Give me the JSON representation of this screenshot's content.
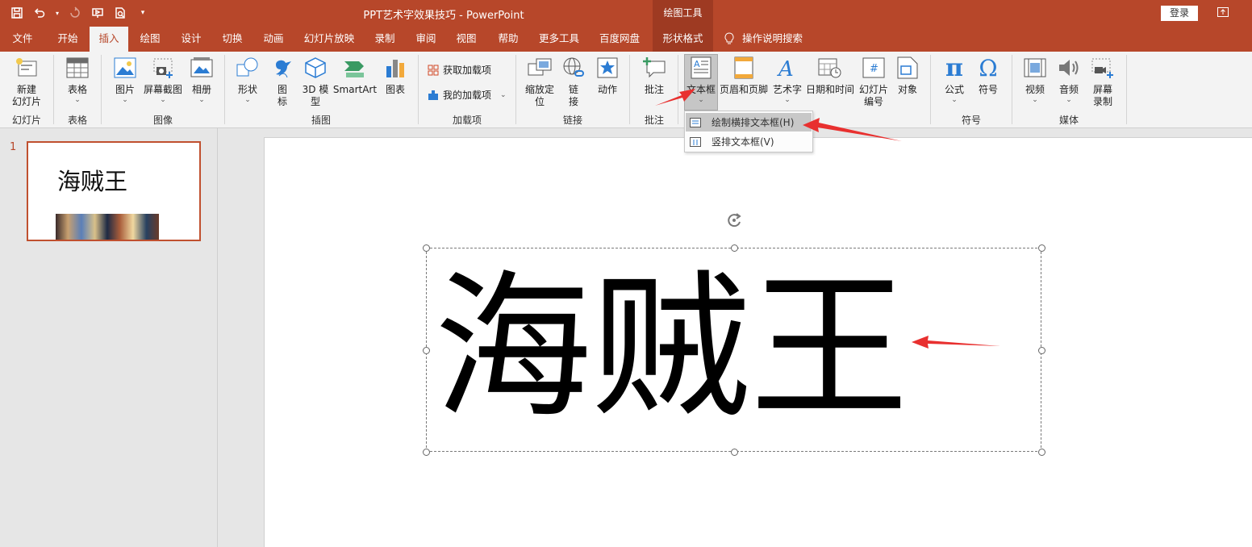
{
  "window": {
    "title": "PPT艺术字效果技巧  -  PowerPoint",
    "context_group": "绘图工具",
    "signin_label": "登录"
  },
  "tabs": [
    {
      "label": "文件"
    },
    {
      "label": "开始"
    },
    {
      "label": "插入",
      "active": true
    },
    {
      "label": "绘图"
    },
    {
      "label": "设计"
    },
    {
      "label": "切换"
    },
    {
      "label": "动画"
    },
    {
      "label": "幻灯片放映"
    },
    {
      "label": "录制"
    },
    {
      "label": "审阅"
    },
    {
      "label": "视图"
    },
    {
      "label": "帮助"
    },
    {
      "label": "更多工具"
    },
    {
      "label": "百度网盘"
    },
    {
      "label": "形状格式"
    }
  ],
  "tell_me": "操作说明搜索",
  "ribbon": {
    "new_slide": {
      "line1": "新建",
      "line2": "幻灯片"
    },
    "table": "表格",
    "pictures": "图片",
    "screenshot": "屏幕截图",
    "album": "相册",
    "shapes": "形状",
    "icons": {
      "line1": "图",
      "line2": "标"
    },
    "model3d": {
      "line1": "3D 模",
      "line2": "型"
    },
    "smartart": "SmartArt",
    "chart": "图表",
    "get_addins": "获取加载项",
    "my_addins": "我的加载项",
    "zoom": {
      "line1": "缩放定",
      "line2": "位"
    },
    "link": {
      "line1": "链",
      "line2": "接"
    },
    "action": "动作",
    "comment": "批注",
    "textbox": "文本框",
    "header_footer": "页眉和页脚",
    "wordart": "艺术字",
    "datetime": "日期和时间",
    "slide_number": {
      "line1": "幻灯片",
      "line2": "编号"
    },
    "object": "对象",
    "equation": "公式",
    "symbol": "符号",
    "video": "视频",
    "audio": "音频",
    "screen_recording": {
      "line1": "屏幕",
      "line2": "录制"
    },
    "groups": {
      "slides": "幻灯片",
      "tables": "表格",
      "images": "图像",
      "illustrations": "插图",
      "addins": "加载项",
      "links": "链接",
      "comments": "批注",
      "symbols": "符号",
      "media": "媒体"
    }
  },
  "textbox_menu": {
    "horizontal": "绘制横排文本框(H)",
    "vertical": "竖排文本框(V)"
  },
  "thumbnails": [
    {
      "number": "1",
      "title": "海贼王"
    }
  ],
  "slide": {
    "text": "海贼王"
  },
  "colors": {
    "accent": "#b7472a",
    "arrow": "#e8302f"
  }
}
